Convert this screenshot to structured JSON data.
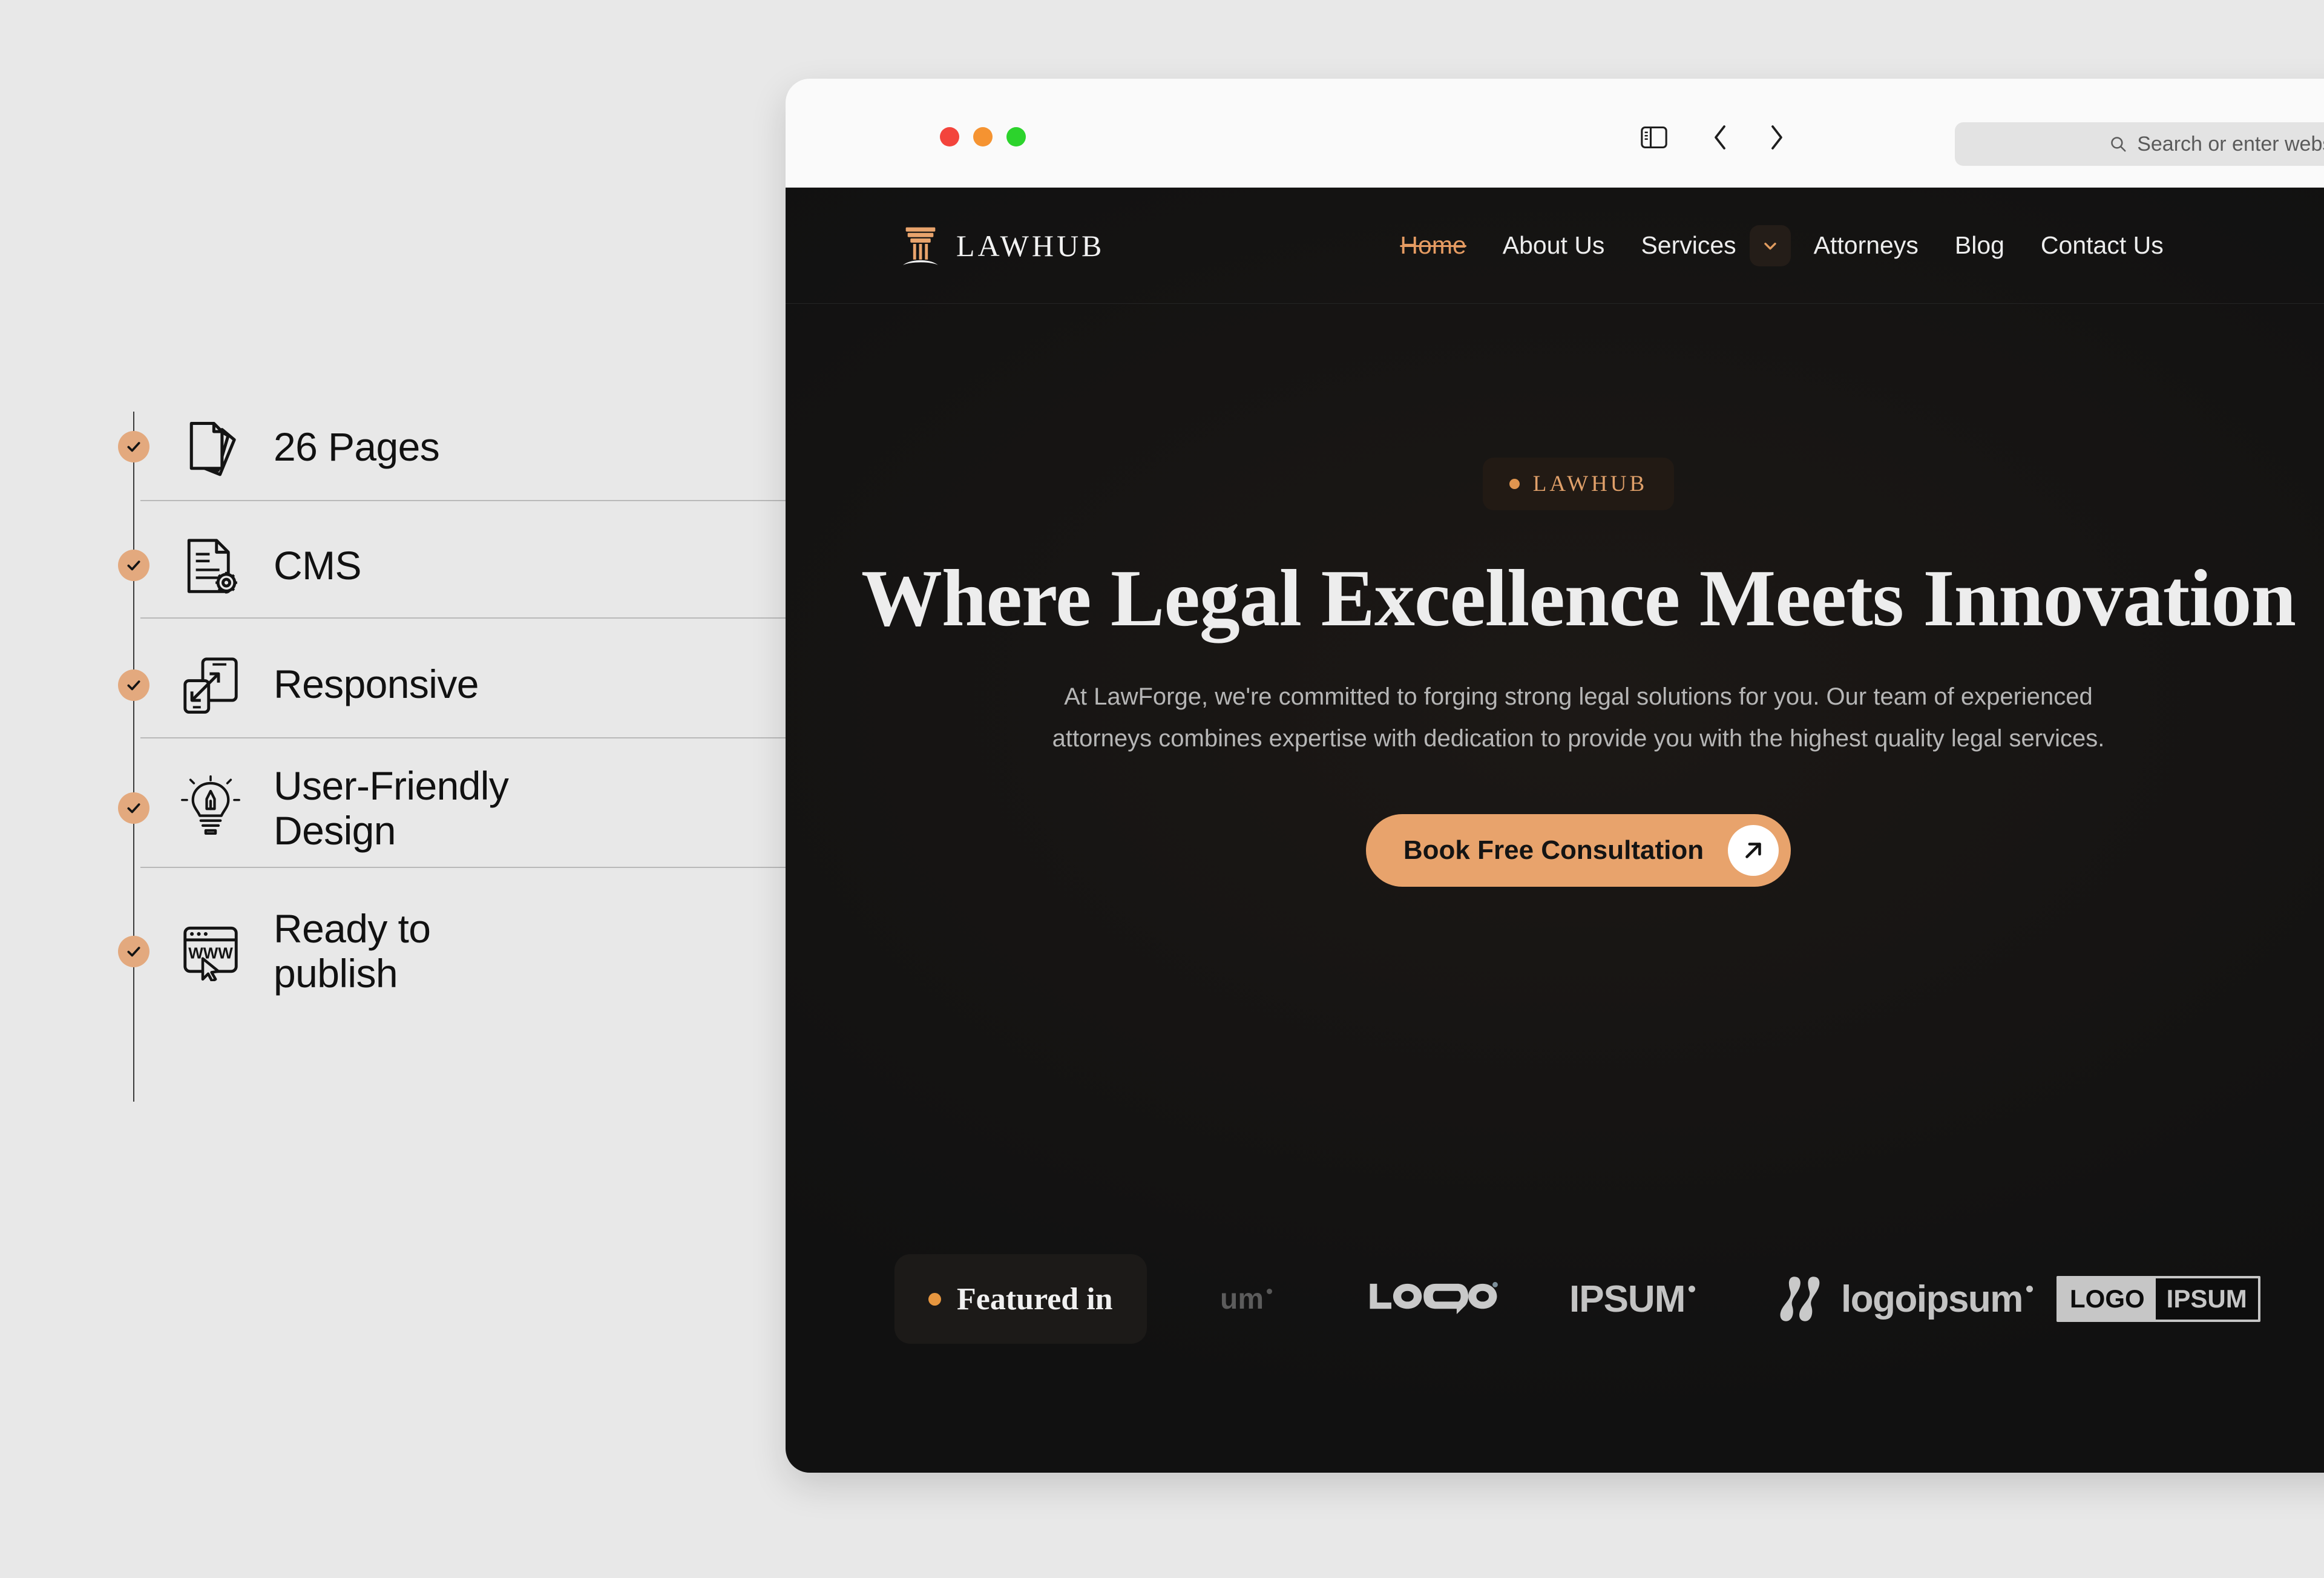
{
  "features": {
    "items": [
      {
        "label": "26 Pages",
        "icon": "stacked-pages-icon"
      },
      {
        "label": "CMS",
        "icon": "document-gear-icon"
      },
      {
        "label": "Responsive",
        "icon": "responsive-devices-icon"
      },
      {
        "label": "User-Friendly\nDesign",
        "icon": "lightbulb-pen-icon"
      },
      {
        "label": "Ready to\npublish",
        "icon": "www-browser-cursor-icon"
      }
    ],
    "check_color": "#e3a97e"
  },
  "browser": {
    "traffic_lights": {
      "close": "close-button",
      "minimize": "minimize-button",
      "zoom": "zoom-button"
    },
    "sidebar_toggle": "sidebar-toggle",
    "back": "back-button",
    "forward": "forward-button",
    "address": {
      "placeholder": "Search or enter website name",
      "value": ""
    }
  },
  "site": {
    "brand": {
      "name": "LAWHUB",
      "mark": "pillar-icon"
    },
    "nav": [
      {
        "label": "Home",
        "active": true,
        "dropdown": false
      },
      {
        "label": "About Us",
        "active": false,
        "dropdown": false
      },
      {
        "label": "Services",
        "active": false,
        "dropdown": true
      },
      {
        "label": "Attorneys",
        "active": false,
        "dropdown": false
      },
      {
        "label": "Blog",
        "active": false,
        "dropdown": false
      },
      {
        "label": "Contact Us",
        "active": false,
        "dropdown": false
      }
    ],
    "hero": {
      "badge": "LAWHUB",
      "title": "Where Legal Excellence Meets Innovation",
      "subtitle": "At LawForge, we're committed to forging strong legal solutions for you. Our team of experienced attorneys combines expertise with dedication to provide you with the highest quality legal services.",
      "cta_label": "Book Free Consultation",
      "cta_icon": "arrow-up-right-icon"
    },
    "featured": {
      "label": "Featured in",
      "logos": [
        {
          "name": "logoipsum-partial",
          "text": "um"
        },
        {
          "name": "logo-wordmark",
          "text": "LOGO"
        },
        {
          "name": "ipsum-wordmark",
          "text": "IPSUM"
        },
        {
          "name": "logoipsum-wordmark",
          "text": "logoipsum"
        },
        {
          "name": "logo-ipsum-boxed",
          "text_left": "LOGO",
          "text_right": "IPSUM"
        }
      ]
    },
    "colors": {
      "background": "#111111",
      "accent": "#e8a36c",
      "accent_text": "#e59b62",
      "text": "#ededed",
      "muted_text": "#b6b6b6"
    }
  }
}
